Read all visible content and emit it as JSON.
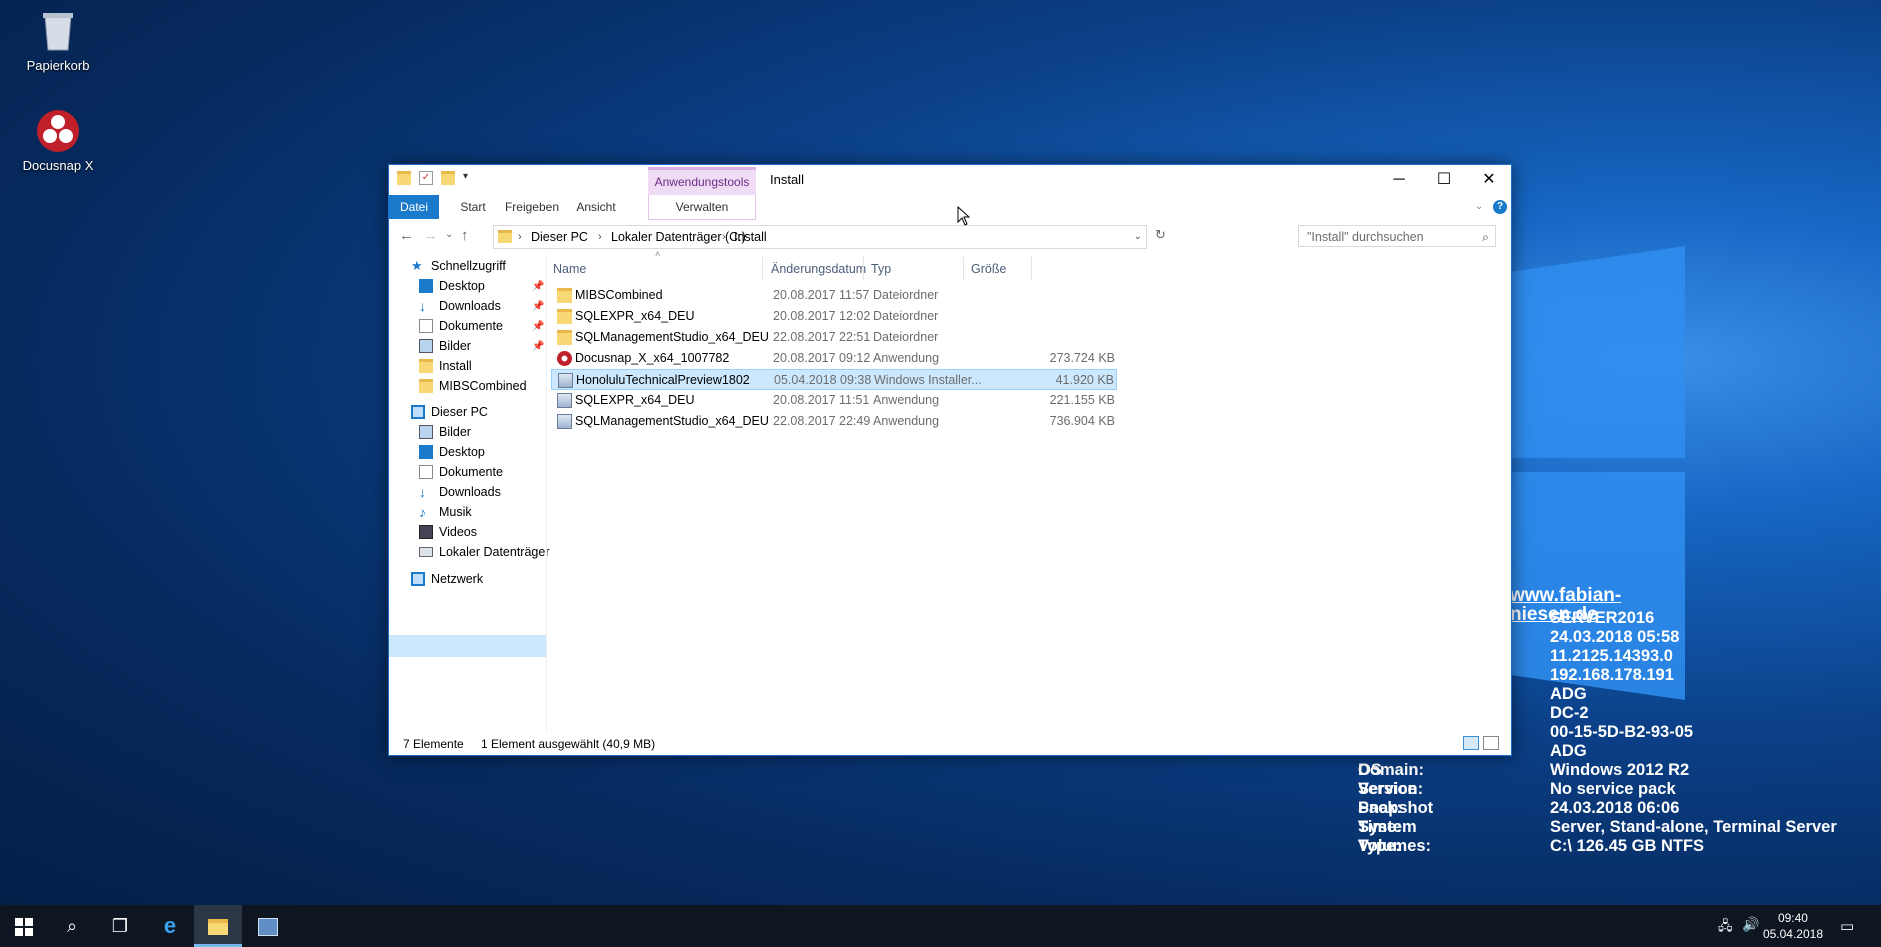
{
  "desktop": {
    "icons": [
      {
        "label": "Papierkorb"
      },
      {
        "label": "Docusnap X"
      }
    ],
    "bginfo": {
      "url": "www.fabian-niesen.de",
      "values_top": [
        "SERVER2016",
        "24.03.2018 05:58",
        "11.2125.14393.0",
        "192.168.178.191",
        "ADG",
        "DC-2",
        "00-15-5D-B2-93-05"
      ],
      "rows": [
        {
          "label": "Machine Domain:",
          "value": "ADG"
        },
        {
          "label": "OS Version:",
          "value": "Windows 2012 R2"
        },
        {
          "label": "Service Pack:",
          "value": "No service pack"
        },
        {
          "label": "Snapshot Time:",
          "value": "24.03.2018 06:06"
        },
        {
          "label": "System Type:",
          "value": "Server, Stand-alone, Terminal Server"
        },
        {
          "label": "Volumes:",
          "value": "C:\\ 126.45 GB NTFS"
        }
      ]
    }
  },
  "window": {
    "title": "Install",
    "context_group": "Anwendungstools",
    "ribbon_tabs": [
      "Datei",
      "Start",
      "Freigeben",
      "Ansicht",
      "Verwalten"
    ],
    "breadcrumb": [
      "Dieser PC",
      "Lokaler Datenträger (C:)",
      "Install"
    ],
    "search_placeholder": "\"Install\" durchsuchen",
    "nav": {
      "quick_access": "Schnellzugriff",
      "quick_items": [
        "Desktop",
        "Downloads",
        "Dokumente",
        "Bilder",
        "Install",
        "MIBSCombined"
      ],
      "this_pc": "Dieser PC",
      "pc_items": [
        "Bilder",
        "Desktop",
        "Dokumente",
        "Downloads",
        "Musik",
        "Videos",
        "Lokaler Datenträger"
      ],
      "network": "Netzwerk"
    },
    "columns": [
      "Name",
      "Änderungsdatum",
      "Typ",
      "Größe"
    ],
    "files": [
      {
        "name": "MIBSCombined",
        "date": "20.08.2017 11:57",
        "type": "Dateiordner",
        "size": "",
        "icon": "folder-icon"
      },
      {
        "name": "SQLEXPR_x64_DEU",
        "date": "20.08.2017 12:02",
        "type": "Dateiordner",
        "size": "",
        "icon": "folder-icon"
      },
      {
        "name": "SQLManagementStudio_x64_DEU",
        "date": "22.08.2017 22:51",
        "type": "Dateiordner",
        "size": "",
        "icon": "folder-icon"
      },
      {
        "name": "Docusnap_X_x64_1007782",
        "date": "20.08.2017 09:12",
        "type": "Anwendung",
        "size": "273.724 KB",
        "icon": "docusnap-icon"
      },
      {
        "name": "HonoluluTechnicalPreview1802",
        "date": "05.04.2018 09:38",
        "type": "Windows Installer...",
        "size": "41.920 KB",
        "icon": "installer-icon"
      },
      {
        "name": "SQLEXPR_x64_DEU",
        "date": "20.08.2017 11:51",
        "type": "Anwendung",
        "size": "221.155 KB",
        "icon": "exe-icon"
      },
      {
        "name": "SQLManagementStudio_x64_DEU",
        "date": "22.08.2017 22:49",
        "type": "Anwendung",
        "size": "736.904 KB",
        "icon": "exe-icon"
      }
    ],
    "status": {
      "count": "7 Elemente",
      "selection": "1 Element ausgewählt (40,9 MB)"
    }
  },
  "taskbar": {
    "time": "09:40",
    "date": "05.04.2018"
  }
}
